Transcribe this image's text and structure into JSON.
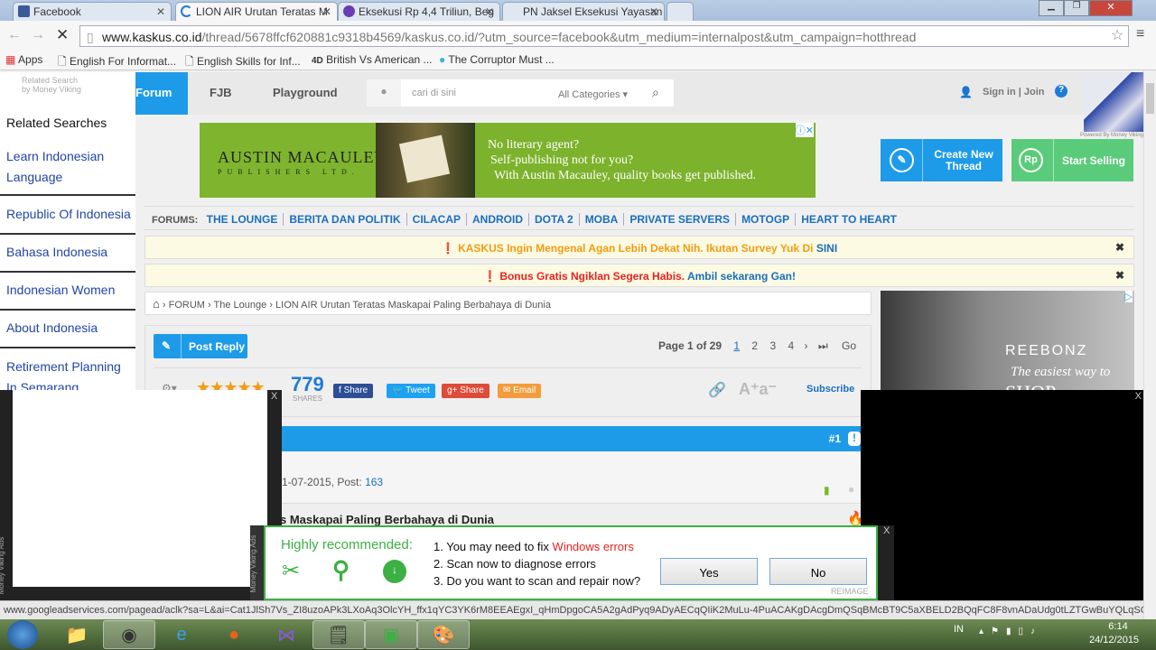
{
  "browser": {
    "tabs": [
      {
        "label": "Facebook"
      },
      {
        "label": "LION AIR Urutan Teratas M"
      },
      {
        "label": "Eksekusi Rp 4,4 Triliun, Beg"
      },
      {
        "label": "PN Jaksel Eksekusi Yayasan"
      }
    ],
    "url_domain": "www.kaskus.co.id",
    "url_path": "/thread/5678ffcf620881c9318b4569/kaskus.co.id/?utm_source=facebook&utm_medium=internalpost&utm_campaign=hotthread",
    "bookmarks": [
      "Apps",
      "English For Informat...",
      "English Skills for Inf...",
      "British Vs American ...",
      "The Corruptor Must ..."
    ]
  },
  "related": {
    "caption": "Related Search\nby Money Viking",
    "title": "Related Searches",
    "items": [
      "Learn Indonesian Language",
      "Republic Of Indonesia",
      "Bahasa Indonesia",
      "Indonesian Women",
      "About Indonesia",
      "Retirement Planning In Semarang"
    ]
  },
  "header": {
    "nav": [
      "Forum",
      "FJB",
      "Playground"
    ],
    "search_placeholder": "cari di sini",
    "category": "All Categories",
    "signin": "Sign in | Join",
    "help": "?",
    "powered": "Powered By Money Viking"
  },
  "ad": {
    "brand": "AUSTIN MACAULEY",
    "brand_sub": "PUBLISHERS LTD.",
    "line1": "No literary agent?",
    "line2": "Self-publishing not for you?",
    "line3": "With Austin Macauley, quality books get published."
  },
  "actions": {
    "create": "Create New Thread",
    "sell": "Start Selling",
    "sell_icon": "Rp"
  },
  "forums": {
    "label": "FORUMS:",
    "items": [
      "THE LOUNGE",
      "BERITA DAN POLITIK",
      "CILACAP",
      "ANDROID",
      "DOTA 2",
      "MOBA",
      "PRIVATE SERVERS",
      "MOTOGP",
      "HEART TO HEART"
    ]
  },
  "notices": [
    {
      "orange": "KASKUS Ingin Mengenal Agan Lebih Dekat Nih. Ikutan Survey Yuk Di",
      "link": "SINI"
    },
    {
      "red": "Bonus Gratis Ngiklan Segera Habis.",
      "link": "Ambil sekarang Gan!"
    }
  ],
  "breadcrumb": [
    "FORUM",
    "The Lounge",
    "LION AIR Urutan Teratas Maskapai Paling Berbahaya di Dunia"
  ],
  "right_ad": {
    "brand": "REEBONZ",
    "tag": "The easiest way to",
    "tag2": "SHOP"
  },
  "thread": {
    "post_reply": "Post Reply",
    "page_info": "Page 1 of 29",
    "pages": [
      "1",
      "2",
      "3",
      "4"
    ],
    "go": "Go",
    "shares": "779",
    "shares_label": "SHARES",
    "share_buttons": [
      "Share",
      "Tweet",
      "Share",
      "Email"
    ],
    "subscribe": "Subscribe",
    "rating": 5,
    "post_num": "#1",
    "post_meta": "1-07-2015, Post: ",
    "post_count": "163",
    "title_fragment": "s Maskapai Paling Berbahaya di Dunia"
  },
  "overlay": {
    "close": "X",
    "side_label": "Money Viking Ads"
  },
  "popup": {
    "heading": "Highly recommended:",
    "l1": "1. You may need to fix ",
    "l1_red": "Windows errors",
    "l2": "2. Scan now to diagnose errors",
    "l3": "3. Do you want to scan and repair now?",
    "yes": "Yes",
    "no": "No",
    "brand": "REIMAGE",
    "close": "X"
  },
  "status": "www.googleadservices.com/pagead/aclk?sa=L&ai=Cat1JlSh7Vs_ZI8uzoAPk3LXoAq3OlcYH_ffx1qYC3YK6rM8EEAEgxI_qHmDpgoCA5A2gAdPyq9ADyAECqQIiK2MuLu-4PuACAKgDAcgDmQSqBMcBT9C5aXBELD2BQqFC8F8vnADaUdg0tLZTGwBuYQLqSGl...",
  "taskbar": {
    "lang": "IN",
    "time": "6:14",
    "date": "24/12/2015"
  }
}
